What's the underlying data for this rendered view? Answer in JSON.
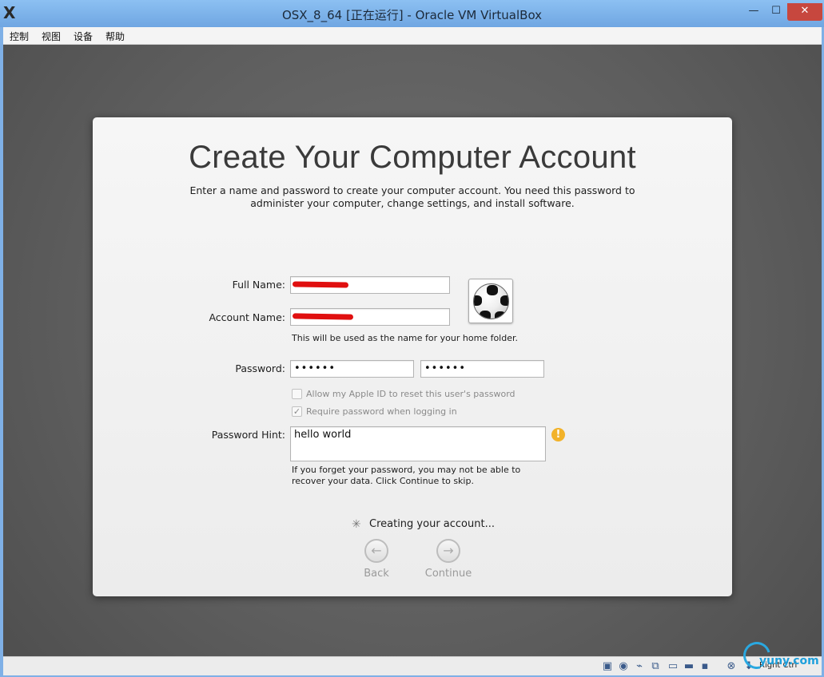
{
  "window": {
    "title": "OSX_8_64 [正在运行] - Oracle VM VirtualBox",
    "app_icon": "X",
    "minimize_glyph": "—",
    "maximize_glyph": "☐",
    "close_glyph": "✕"
  },
  "menubar": {
    "items": [
      {
        "label": "控制"
      },
      {
        "label": "视图"
      },
      {
        "label": "设备"
      },
      {
        "label": "帮助"
      }
    ]
  },
  "setup": {
    "heading": "Create Your Computer Account",
    "subtitle": "Enter a name and password to create your computer account. You need this password to administer your computer, change settings, and install software.",
    "full_name_label": "Full Name:",
    "full_name_value": "",
    "account_name_label": "Account Name:",
    "account_name_value": "",
    "home_folder_note": "This will be used as the name for your home folder.",
    "password_label": "Password:",
    "password_value": "••••••",
    "verify_value": "••••••",
    "apple_id_reset_label": "Allow my Apple ID to reset this user's password",
    "require_password_label": "Require password when logging in",
    "require_password_glyph": "✓",
    "hint_label": "Password Hint:",
    "hint_value": "hello world",
    "hint_note_line1": "If you forget your password, you may not be able to",
    "hint_note_line2": "recover your data. Click Continue to skip.",
    "warning_glyph": "!",
    "status_text": "Creating your account...",
    "spinner_glyph": "✳",
    "back_label": "Back",
    "back_glyph": "←",
    "continue_label": "Continue",
    "continue_glyph": "→"
  },
  "statusbar": {
    "icons": [
      "hard-disk-icon",
      "optical-drive-icon",
      "usb-icon",
      "network-icon",
      "shared-folder-icon",
      "display-icon",
      "video-capture-icon",
      "mouse-integration-icon",
      "host-key-icon"
    ],
    "host_key_label": "Right Ctrl"
  },
  "watermark": {
    "text": "yuny.com"
  },
  "colors": {
    "redaction": "#e00f0f",
    "warning": "#f2b229",
    "titlebar": "#7fb0e6"
  }
}
